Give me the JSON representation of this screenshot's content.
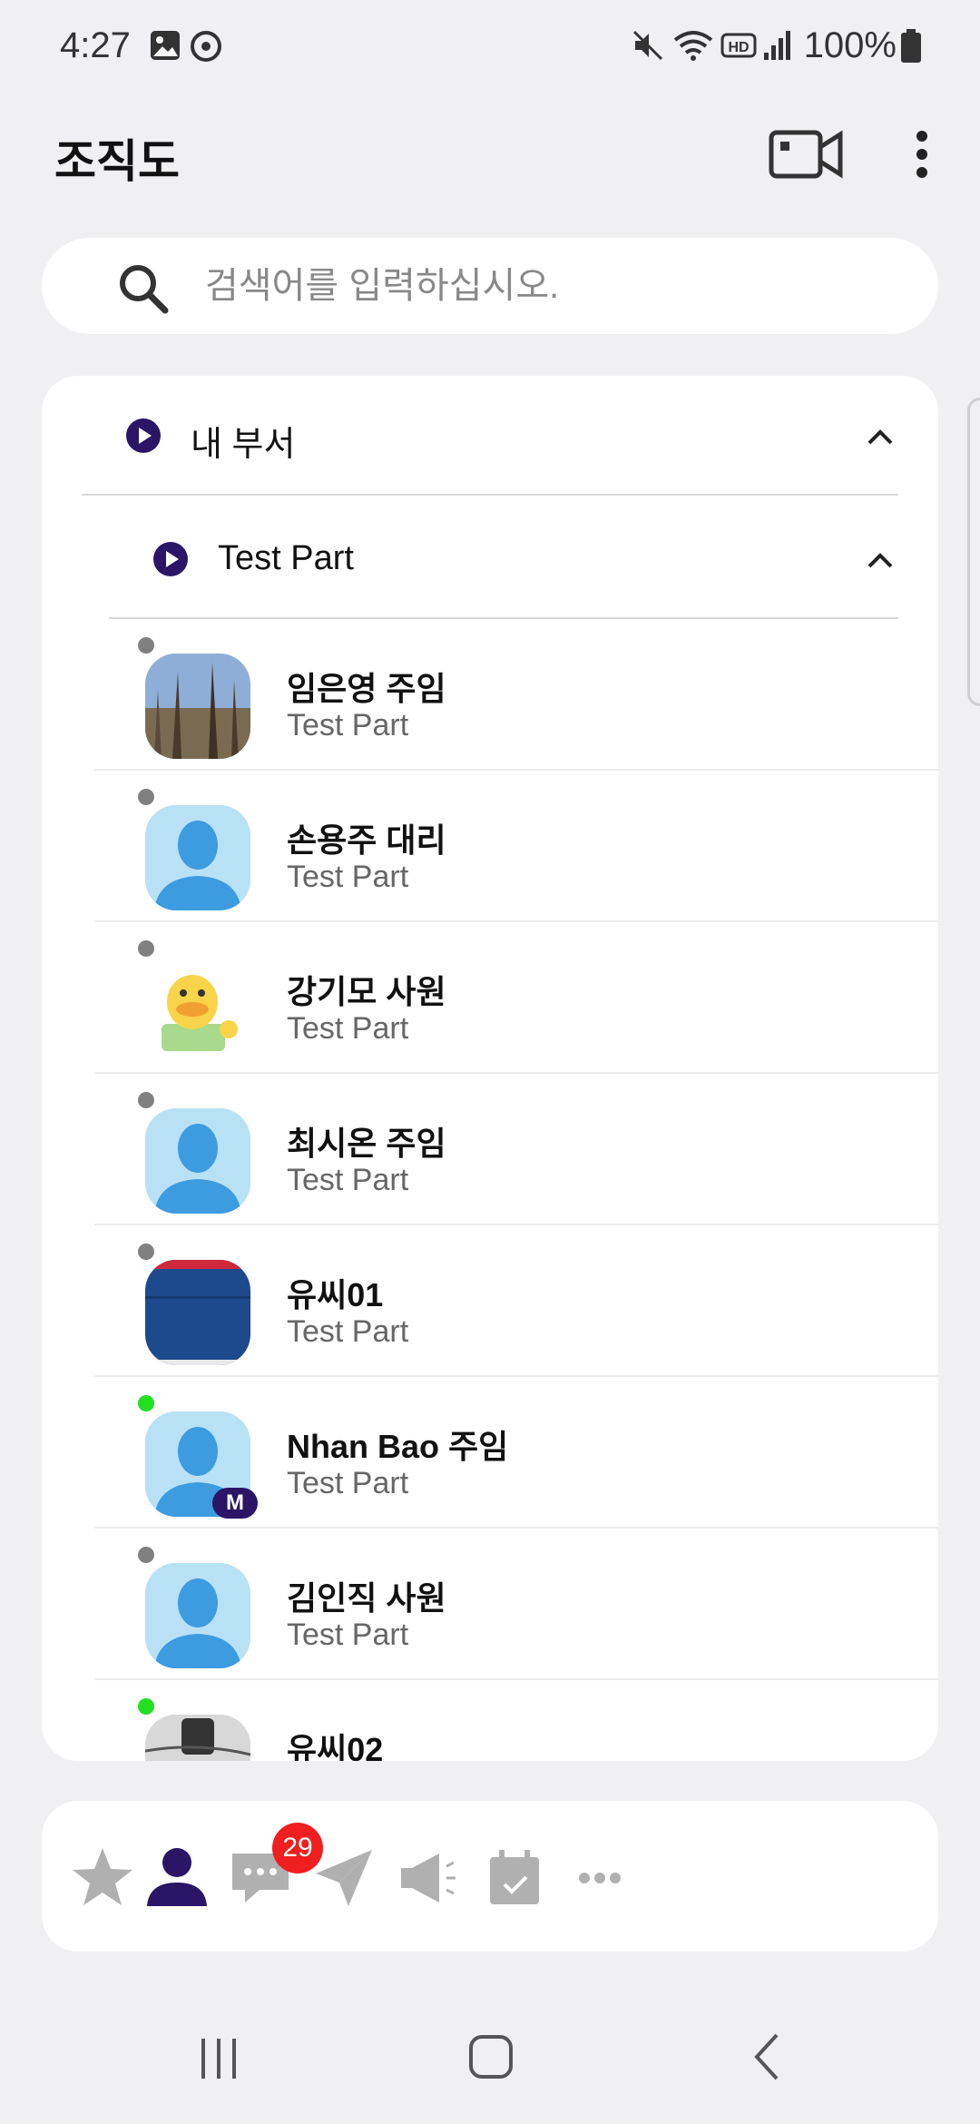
{
  "status_bar": {
    "time": "4:27",
    "battery": "100%"
  },
  "header": {
    "title": "조직도"
  },
  "search": {
    "placeholder": "검색어를 입력하십시오."
  },
  "tree": {
    "my_dept_label": "내 부서",
    "sub_dept_label": "Test Part"
  },
  "members": [
    {
      "name": "임은영 주임",
      "dept": "Test Part",
      "status": "offline",
      "avatar": "photo-forest"
    },
    {
      "name": "손용주 대리",
      "dept": "Test Part",
      "status": "offline",
      "avatar": "default-person"
    },
    {
      "name": "강기모 사원",
      "dept": "Test Part",
      "status": "offline",
      "avatar": "duck-character"
    },
    {
      "name": "최시온 주임",
      "dept": "Test Part",
      "status": "offline",
      "avatar": "default-person"
    },
    {
      "name": "유씨01",
      "dept": "Test Part",
      "status": "offline",
      "avatar": "blue-fabric"
    },
    {
      "name": "Nhan Bao 주임",
      "dept": "Test Part",
      "status": "online",
      "avatar": "default-person",
      "badge": "M"
    },
    {
      "name": "김인직 사원",
      "dept": "Test Part",
      "status": "offline",
      "avatar": "default-person"
    },
    {
      "name": "유씨02",
      "dept": "",
      "status": "online",
      "avatar": "photo-device"
    }
  ],
  "tabs": {
    "items": [
      "favorites",
      "organization",
      "chat",
      "send",
      "notice",
      "calendar",
      "more"
    ],
    "chat_badge": "29"
  },
  "colors": {
    "accent": "#2a1566",
    "online": "#21e021",
    "offline": "#808080",
    "badge": "#f01e1e"
  }
}
